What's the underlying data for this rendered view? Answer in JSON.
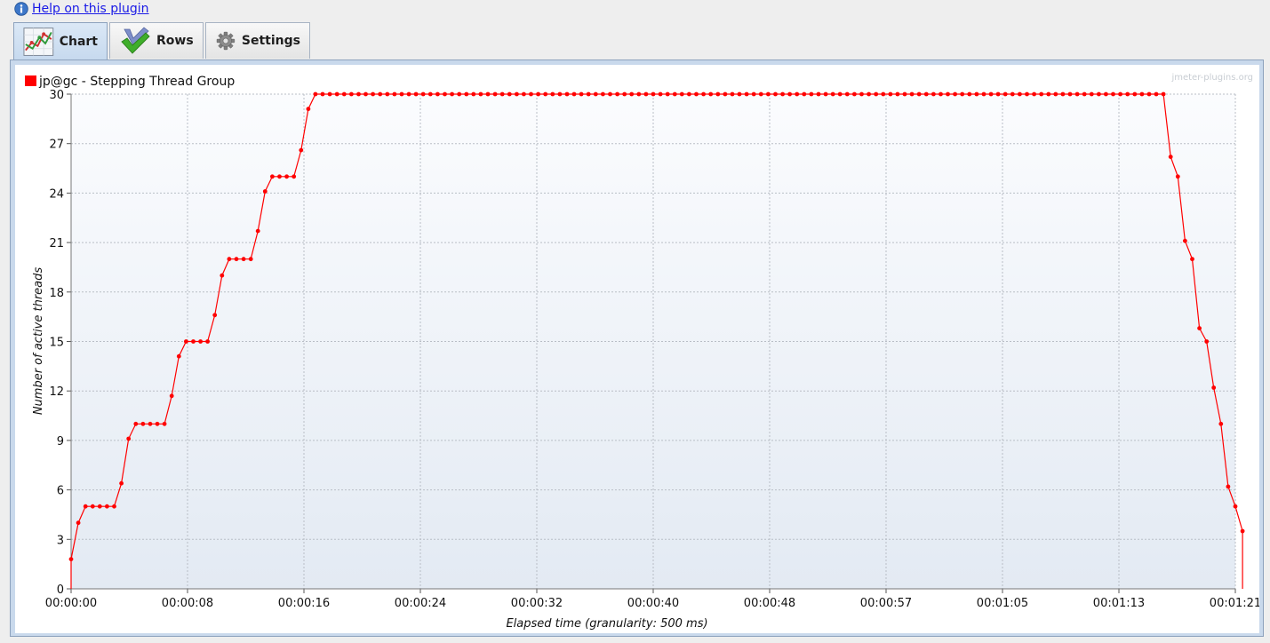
{
  "help": {
    "link_text": "Help on this plugin",
    "icon": "info-icon"
  },
  "tabs": [
    {
      "label": "Chart",
      "icon": "chart-icon",
      "active": true
    },
    {
      "label": "Rows",
      "icon": "checkmark-icon",
      "active": false
    },
    {
      "label": "Settings",
      "icon": "gear-icon",
      "active": false
    }
  ],
  "chart": {
    "watermark": "jmeter-plugins.org",
    "legend_color": "#ff0000",
    "line_color": "#ff0000"
  },
  "chart_data": {
    "type": "line",
    "title": "",
    "xlabel": "Elapsed time (granularity: 500 ms)",
    "ylabel": "Number of active threads",
    "ylim": [
      0,
      30
    ],
    "xlim_seconds": [
      0,
      81
    ],
    "y_ticks": [
      "0",
      "3",
      "6",
      "9",
      "12",
      "15",
      "18",
      "21",
      "24",
      "27",
      "30"
    ],
    "x_tick_labels": [
      "00:00:00",
      "00:00:08",
      "00:00:16",
      "00:00:24",
      "00:00:32",
      "00:00:40",
      "00:00:48",
      "00:00:57",
      "00:01:05",
      "00:01:13",
      "00:01:21"
    ],
    "grid": true,
    "legend_position": "top-left",
    "series": [
      {
        "name": "jp@gc - Stepping Thread Group",
        "color": "#ff0000",
        "points": [
          [
            0.0,
            0
          ],
          [
            0.0,
            1.8
          ],
          [
            0.5,
            4.0
          ],
          [
            1.0,
            5
          ],
          [
            1.5,
            5
          ],
          [
            2.0,
            5
          ],
          [
            2.5,
            5
          ],
          [
            3.0,
            5
          ],
          [
            3.5,
            6.4
          ],
          [
            4.0,
            9.1
          ],
          [
            4.5,
            10
          ],
          [
            5.0,
            10
          ],
          [
            5.5,
            10
          ],
          [
            6.0,
            10
          ],
          [
            6.5,
            10
          ],
          [
            7.0,
            11.7
          ],
          [
            7.5,
            14.1
          ],
          [
            8.0,
            15
          ],
          [
            8.5,
            15
          ],
          [
            9.0,
            15
          ],
          [
            9.5,
            15
          ],
          [
            10.0,
            16.6
          ],
          [
            10.5,
            19.0
          ],
          [
            11.0,
            20
          ],
          [
            11.5,
            20
          ],
          [
            12.0,
            20
          ],
          [
            12.5,
            20
          ],
          [
            13.0,
            21.7
          ],
          [
            13.5,
            24.1
          ],
          [
            14.0,
            25
          ],
          [
            14.5,
            25
          ],
          [
            15.0,
            25
          ],
          [
            15.5,
            25
          ],
          [
            16.0,
            26.6
          ],
          [
            16.5,
            29.1
          ],
          [
            17.0,
            30
          ],
          [
            17.5,
            30
          ],
          [
            18.0,
            30
          ],
          [
            18.5,
            30
          ],
          [
            19.0,
            30
          ],
          [
            19.5,
            30
          ],
          [
            20.0,
            30
          ],
          [
            20.5,
            30
          ],
          [
            21.0,
            30
          ],
          [
            21.5,
            30
          ],
          [
            22.0,
            30
          ],
          [
            22.5,
            30
          ],
          [
            23.0,
            30
          ],
          [
            23.5,
            30
          ],
          [
            24.0,
            30
          ],
          [
            24.5,
            30
          ],
          [
            25.0,
            30
          ],
          [
            25.5,
            30
          ],
          [
            26.0,
            30
          ],
          [
            26.5,
            30
          ],
          [
            27.0,
            30
          ],
          [
            27.5,
            30
          ],
          [
            28.0,
            30
          ],
          [
            28.5,
            30
          ],
          [
            29.0,
            30
          ],
          [
            29.5,
            30
          ],
          [
            30.0,
            30
          ],
          [
            30.5,
            30
          ],
          [
            31.0,
            30
          ],
          [
            31.5,
            30
          ],
          [
            32.0,
            30
          ],
          [
            32.5,
            30
          ],
          [
            33.0,
            30
          ],
          [
            33.5,
            30
          ],
          [
            34.0,
            30
          ],
          [
            34.5,
            30
          ],
          [
            35.0,
            30
          ],
          [
            35.5,
            30
          ],
          [
            36.0,
            30
          ],
          [
            36.5,
            30
          ],
          [
            37.0,
            30
          ],
          [
            37.5,
            30
          ],
          [
            38.0,
            30
          ],
          [
            38.5,
            30
          ],
          [
            39.0,
            30
          ],
          [
            39.5,
            30
          ],
          [
            40.0,
            30
          ],
          [
            40.5,
            30
          ],
          [
            41.0,
            30
          ],
          [
            41.5,
            30
          ],
          [
            42.0,
            30
          ],
          [
            42.5,
            30
          ],
          [
            43.0,
            30
          ],
          [
            43.5,
            30
          ],
          [
            44.0,
            30
          ],
          [
            44.5,
            30
          ],
          [
            45.0,
            30
          ],
          [
            45.5,
            30
          ],
          [
            46.0,
            30
          ],
          [
            46.5,
            30
          ],
          [
            47.0,
            30
          ],
          [
            47.5,
            30
          ],
          [
            48.0,
            30
          ],
          [
            48.5,
            30
          ],
          [
            49.0,
            30
          ],
          [
            49.5,
            30
          ],
          [
            50.0,
            30
          ],
          [
            50.5,
            30
          ],
          [
            51.0,
            30
          ],
          [
            51.5,
            30
          ],
          [
            52.0,
            30
          ],
          [
            52.5,
            30
          ],
          [
            53.0,
            30
          ],
          [
            53.5,
            30
          ],
          [
            54.0,
            30
          ],
          [
            54.5,
            30
          ],
          [
            55.0,
            30
          ],
          [
            55.5,
            30
          ],
          [
            56.0,
            30
          ],
          [
            56.5,
            30
          ],
          [
            57.0,
            30
          ],
          [
            57.5,
            30
          ],
          [
            58.0,
            30
          ],
          [
            58.5,
            30
          ],
          [
            59.0,
            30
          ],
          [
            59.5,
            30
          ],
          [
            60.0,
            30
          ],
          [
            60.5,
            30
          ],
          [
            61.0,
            30
          ],
          [
            61.5,
            30
          ],
          [
            62.0,
            30
          ],
          [
            62.5,
            30
          ],
          [
            63.0,
            30
          ],
          [
            63.5,
            30
          ],
          [
            64.0,
            30
          ],
          [
            64.5,
            30
          ],
          [
            65.0,
            30
          ],
          [
            65.5,
            30
          ],
          [
            66.0,
            30
          ],
          [
            66.5,
            30
          ],
          [
            67.0,
            30
          ],
          [
            67.5,
            30
          ],
          [
            68.0,
            30
          ],
          [
            68.5,
            30
          ],
          [
            69.0,
            30
          ],
          [
            69.5,
            30
          ],
          [
            70.0,
            30
          ],
          [
            70.5,
            30
          ],
          [
            71.0,
            30
          ],
          [
            71.5,
            30
          ],
          [
            72.0,
            30
          ],
          [
            72.5,
            30
          ],
          [
            73.0,
            30
          ],
          [
            73.5,
            30
          ],
          [
            74.0,
            30
          ],
          [
            74.5,
            30
          ],
          [
            75.0,
            30
          ],
          [
            75.5,
            30
          ],
          [
            76.0,
            30
          ],
          [
            76.5,
            26.2
          ],
          [
            77.0,
            25
          ],
          [
            77.5,
            21.1
          ],
          [
            78.0,
            20
          ],
          [
            78.5,
            15.8
          ],
          [
            79.0,
            15
          ],
          [
            79.5,
            12.2
          ],
          [
            80.0,
            10
          ],
          [
            80.5,
            6.2
          ],
          [
            81.0,
            5
          ],
          [
            81.5,
            3.5
          ],
          [
            81.5,
            0
          ]
        ]
      }
    ]
  }
}
